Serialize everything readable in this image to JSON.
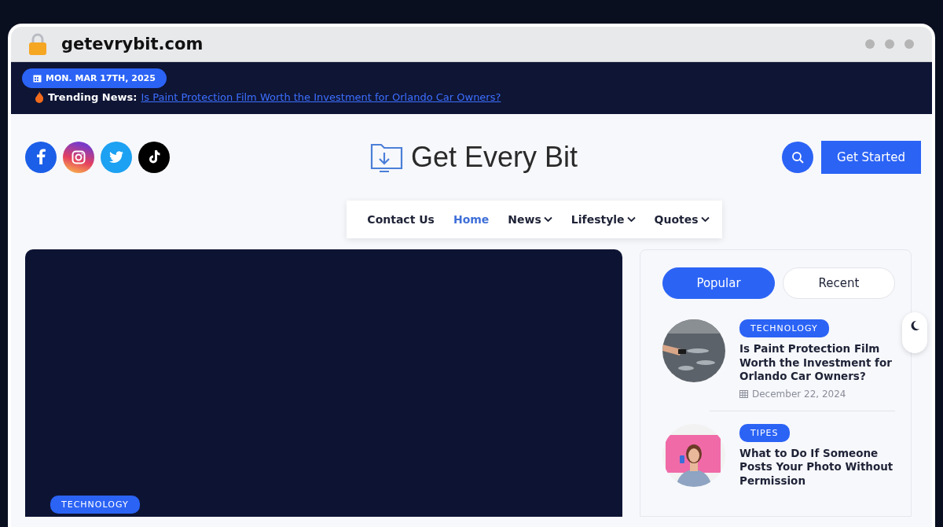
{
  "browser": {
    "url": "getevrybit.com"
  },
  "top_bar": {
    "date": "MON. MAR 17TH, 2025",
    "trending_label": "Trending News:",
    "trending_link": "Is Paint Protection Film Worth the Investment for Orlando Car Owners?"
  },
  "header": {
    "socials": [
      {
        "kind": "facebook"
      },
      {
        "kind": "instagram"
      },
      {
        "kind": "twitter"
      },
      {
        "kind": "tiktok"
      }
    ],
    "logo": "Get Every Bit",
    "cta": "Get Started"
  },
  "nav": [
    {
      "label": "Contact Us",
      "selected": false,
      "dropdown": false
    },
    {
      "label": "Home",
      "selected": true,
      "dropdown": false
    },
    {
      "label": "News",
      "selected": false,
      "dropdown": true
    },
    {
      "label": "Lifestyle",
      "selected": false,
      "dropdown": true
    },
    {
      "label": "Quotes",
      "selected": false,
      "dropdown": true
    }
  ],
  "featured": {
    "category": "TECHNOLOGY"
  },
  "sidebar": {
    "tabs": [
      {
        "label": "Popular",
        "selected": true
      },
      {
        "label": "Recent",
        "selected": false
      }
    ],
    "posts": [
      {
        "category": "TECHNOLOGY",
        "title": "Is Paint Protection Film Worth the Investment for Orlando Car Owners?",
        "date": "December 22, 2024",
        "kind": "car"
      },
      {
        "category": "TIPES",
        "title": "What to Do If Someone Posts Your Photo Without Permission",
        "kind": "person"
      }
    ]
  }
}
